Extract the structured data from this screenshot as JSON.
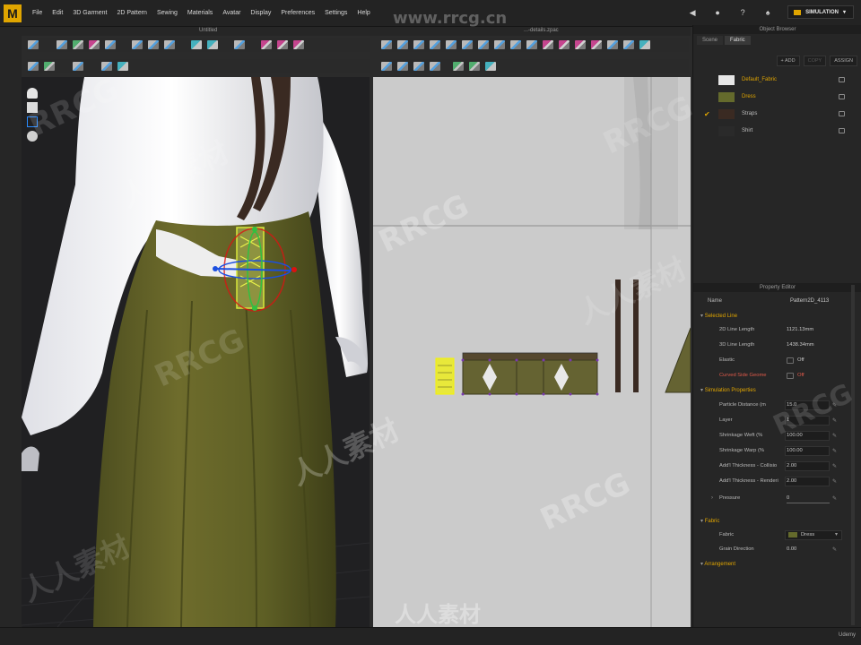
{
  "app": {
    "logo_letter": "M",
    "menu": [
      "File",
      "Edit",
      "3D Garment",
      "2D Pattern",
      "Sewing",
      "Materials",
      "Avatar",
      "Display",
      "Preferences",
      "Settings",
      "Help"
    ],
    "mode_label": "SIMULATION",
    "watermark_url": "www.rrcg.cn",
    "watermark_text": [
      "RRCG",
      "人人素材"
    ]
  },
  "viewport3d": {
    "title": "Untitled"
  },
  "viewport2d": {
    "title": "...-details.zpac"
  },
  "object_browser": {
    "header": "Object Browser",
    "tabs": [
      "Scene",
      "Fabric"
    ],
    "actions": [
      "+ ADD",
      "COPY",
      "ASSIGN"
    ],
    "fabrics": [
      {
        "name": "Default_Fabric",
        "color": "#e6e6e6",
        "name_color": "#e0a500",
        "checked": false
      },
      {
        "name": "Dress",
        "color": "#646a2c",
        "name_color": "#e0a500",
        "checked": false
      },
      {
        "name": "Straps",
        "color": "#3a2a22",
        "name_color": "#bdbdbd",
        "checked": true
      },
      {
        "name": "Shirt",
        "color": "#2a2a2a",
        "name_color": "#bdbdbd",
        "checked": false
      }
    ]
  },
  "property_editor": {
    "header": "Property Editor",
    "name_label": "Name",
    "name_value": "Pattern2D_4113",
    "selected_line": {
      "title": "Selected Line",
      "line_2d_label": "2D Line Length",
      "line_2d_value": "1121.13mm",
      "line_3d_label": "3D Line Length",
      "line_3d_value": "1438.34mm",
      "elastic_label": "Elastic",
      "elastic_value": "Off",
      "curved_label": "Curved Side Geome",
      "curved_value": "Off"
    },
    "simulation": {
      "title": "Simulation Properties",
      "particle_label": "Particle Distance (m",
      "particle_value": "15.0",
      "layer_label": "Layer",
      "layer_value": "1",
      "weft_label": "Shrinkage Weft (%",
      "weft_value": "100.00",
      "warp_label": "Shrinkage Warp (%",
      "warp_value": "100.00",
      "collision_label": "Add'l Thickness - Collisio",
      "collision_value": "2.00",
      "rendering_label": "Add'l Thickness - Renderi",
      "rendering_value": "2.00",
      "pressure_label": "Pressure",
      "pressure_value": "0"
    },
    "fabric": {
      "title": "Fabric",
      "fabric_label": "Fabric",
      "fabric_value": "Dress",
      "grain_label": "Grain Direction",
      "grain_value": "0.00"
    },
    "arrangement": {
      "title": "Arrangement"
    }
  },
  "bottom": {
    "udemy": "Udemy"
  }
}
